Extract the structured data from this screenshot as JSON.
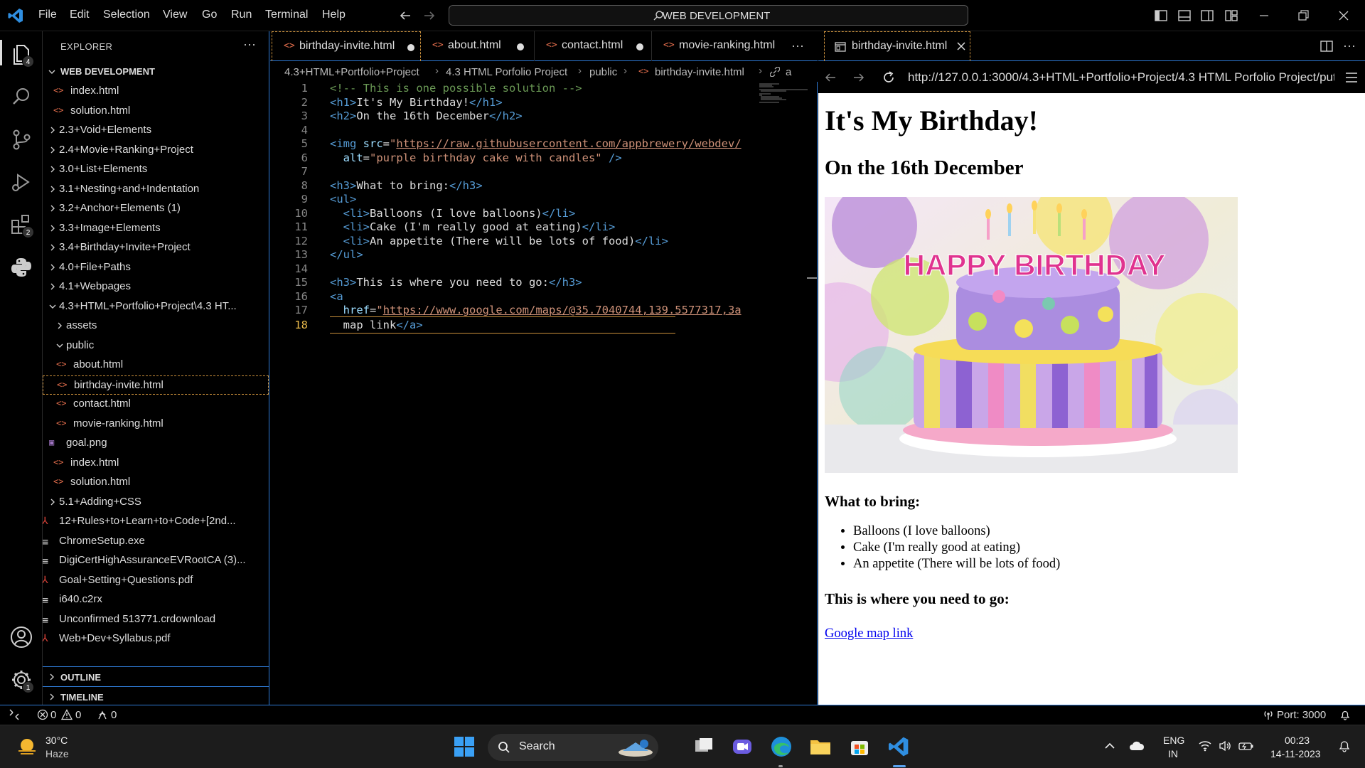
{
  "titlebar": {
    "menu": [
      "File",
      "Edit",
      "Selection",
      "View",
      "Go",
      "Run",
      "Terminal",
      "Help"
    ],
    "search_label": "WEB DEVELOPMENT"
  },
  "activitybar": {
    "explorer_badge": "4",
    "extensions_badge": "2",
    "settings_badge": "1"
  },
  "sidebar": {
    "title": "EXPLORER",
    "workspace": "WEB DEVELOPMENT",
    "items": [
      {
        "label": "index.html",
        "kind": "html"
      },
      {
        "label": "solution.html",
        "kind": "html"
      },
      {
        "label": "2.3+Void+Elements",
        "kind": "folder"
      },
      {
        "label": "2.4+Movie+Ranking+Project",
        "kind": "folder"
      },
      {
        "label": "3.0+List+Elements",
        "kind": "folder"
      },
      {
        "label": "3.1+Nesting+and+Indentation",
        "kind": "folder"
      },
      {
        "label": "3.2+Anchor+Elements (1)",
        "kind": "folder"
      },
      {
        "label": "3.3+Image+Elements",
        "kind": "folder"
      },
      {
        "label": "3.4+Birthday+Invite+Project",
        "kind": "folder"
      },
      {
        "label": "4.0+File+Paths",
        "kind": "folder"
      },
      {
        "label": "4.1+Webpages",
        "kind": "folder"
      },
      {
        "label": "4.3+HTML+Portfolio+Project\\4.3 HT...",
        "kind": "folder-open"
      },
      {
        "label": "assets",
        "kind": "folder"
      },
      {
        "label": "public",
        "kind": "folder-open"
      },
      {
        "label": "about.html",
        "kind": "html"
      },
      {
        "label": "birthday-invite.html",
        "kind": "html"
      },
      {
        "label": "contact.html",
        "kind": "html"
      },
      {
        "label": "movie-ranking.html",
        "kind": "html"
      },
      {
        "label": "goal.png",
        "kind": "image"
      },
      {
        "label": "index.html",
        "kind": "html"
      },
      {
        "label": "solution.html",
        "kind": "html"
      },
      {
        "label": "5.1+Adding+CSS",
        "kind": "folder"
      },
      {
        "label": "12+Rules+to+Learn+to+Code+[2nd...",
        "kind": "pdf"
      },
      {
        "label": "ChromeSetup.exe",
        "kind": "file"
      },
      {
        "label": "DigiCertHighAssuranceEVRootCA (3)...",
        "kind": "file"
      },
      {
        "label": "Goal+Setting+Questions.pdf",
        "kind": "pdf"
      },
      {
        "label": "i640.c2rx",
        "kind": "file"
      },
      {
        "label": "Unconfirmed 513771.crdownload",
        "kind": "file"
      },
      {
        "label": "Web+Dev+Syllabus.pdf",
        "kind": "pdf"
      }
    ],
    "outline": "OUTLINE",
    "timeline": "TIMELINE"
  },
  "editor": {
    "tabs": [
      "birthday-invite.html",
      "about.html",
      "contact.html",
      "movie-ranking.html"
    ],
    "more": "···",
    "breadcrumb": [
      "4.3+HTML+Portfolio+Project",
      "4.3 HTML Porfolio Project",
      "public",
      "birthday-invite.html",
      "a"
    ],
    "lines": [
      "<!-- This is one possible solution -->",
      "<h1>It's My Birthday!</h1>",
      "<h2>On the 16th December</h2>",
      "",
      "<img src=\"https://raw.githubusercontent.com/appbrewery/webdev/",
      "  alt=\"purple birthday cake with candles\" />",
      "",
      "<h3>What to bring:</h3>",
      "<ul>",
      "  <li>Balloons (I love balloons)</li>",
      "  <li>Cake (I'm really good at eating)</li>",
      "  <li>An appetite (There will be lots of food)</li>",
      "</ul>",
      "",
      "<h3>This is where you need to go:</h3>",
      "<a",
      "  href=\"https://www.google.com/maps/@35.7040744,139.5577317,3a",
      "  map link</a>"
    ]
  },
  "preview": {
    "tab_label": "birthday-invite.html",
    "url": "http://127.0.0.1:3000/4.3+HTML+Portfolio+Project/4.3 HTML Porfolio Project/put",
    "h1": "It's My Birthday!",
    "h2": "On the 16th December",
    "cake_text": "HAPPY BIRTHDAY",
    "what_to_bring": "What to bring:",
    "list": [
      "Balloons (I love balloons)",
      "Cake (I'm really good at eating)",
      "An appetite (There will be lots of food)"
    ],
    "where": "This is where you need to go:",
    "link": "Google map link"
  },
  "statusbar": {
    "errors": "0",
    "warnings": "0",
    "ports": "0",
    "port_label": "Port: 3000"
  },
  "taskbar": {
    "weather_temp": "30°C",
    "weather_desc": "Haze",
    "search_label": "Search",
    "lang": "ENG",
    "region": "IN",
    "time": "00:23",
    "date": "14-11-2023"
  },
  "colors": {
    "accent": "#2f7bd6",
    "html_icon": "#e06c4b",
    "modified_border": "#c98f3b"
  }
}
